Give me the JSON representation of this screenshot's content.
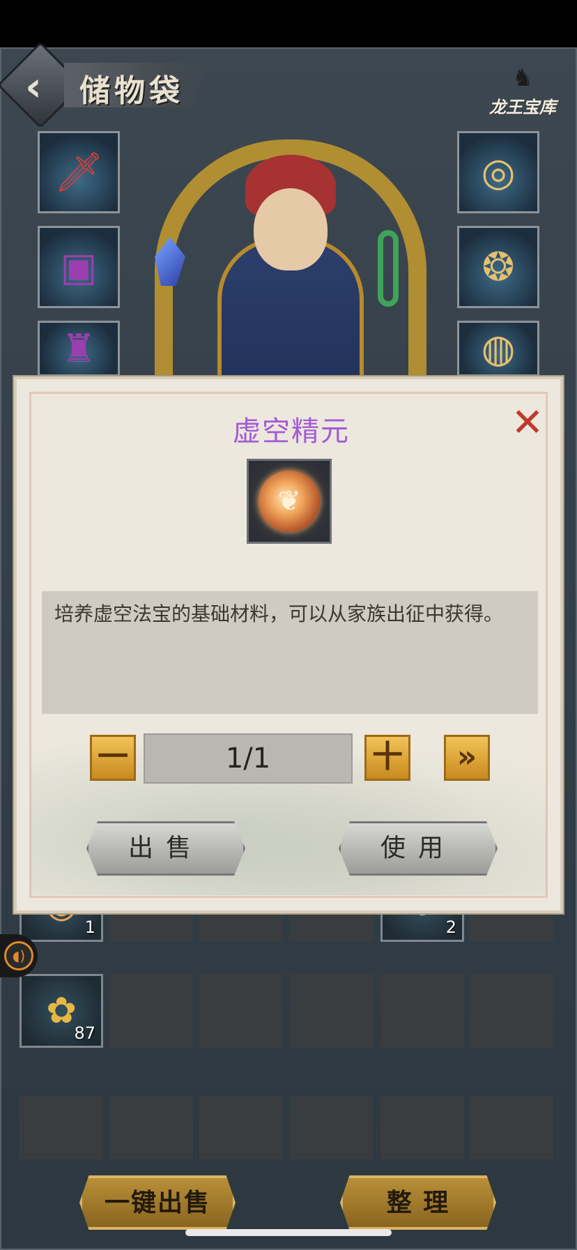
{
  "header": {
    "title": "储物袋",
    "treasury_label": "龙王宝库"
  },
  "equipment": {
    "left": [
      "sword-icon",
      "chest-armor-icon",
      "robe-icon"
    ],
    "right": [
      "ring-icon",
      "pendant-icon",
      "bracelet-icon"
    ]
  },
  "bag": {
    "items": [
      {
        "icon": "void-essence-orb-icon",
        "count": "1"
      },
      {
        "icon": "vase-icon",
        "count": "2"
      },
      {
        "icon": "herb-icon",
        "count": "87"
      }
    ],
    "sell_all_label": "一键出售",
    "sort_label": "整 理"
  },
  "dialog": {
    "item_name": "虚空精元",
    "item_name_color": "#a35ad6",
    "description": "培养虚空法宝的基础材料，可以从家族出征中获得。",
    "quantity": "1/1",
    "minus_label": "一",
    "plus_label": "十",
    "max_label": "»",
    "sell_label": "出售",
    "use_label": "使用",
    "close_icon": "close-icon"
  }
}
